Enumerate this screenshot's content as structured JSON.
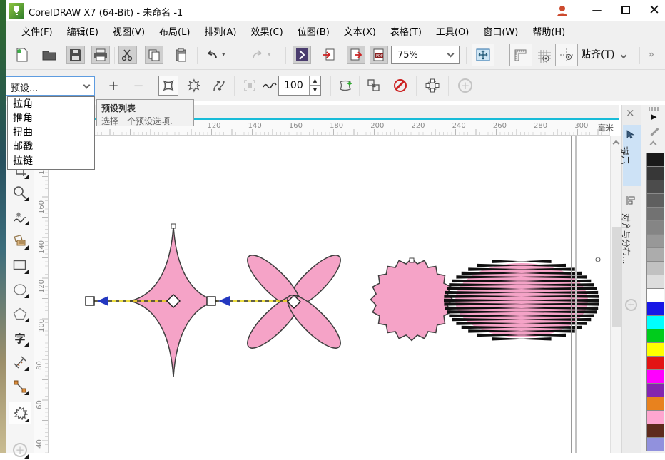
{
  "window": {
    "title": "CorelDRAW X7 (64-Bit) - 未命名 -1",
    "minimize_glyph": "—",
    "close_glyph": "✕"
  },
  "menu": {
    "items": [
      "文件(F)",
      "编辑(E)",
      "视图(V)",
      "布局(L)",
      "排列(A)",
      "效果(C)",
      "位图(B)",
      "文本(X)",
      "表格(T)",
      "工具(O)",
      "窗口(W)",
      "帮助(H)"
    ]
  },
  "toolbar": {
    "zoom_level": "75%",
    "snap_label": "贴齐(T)",
    "overflow_label": "»"
  },
  "property_bar": {
    "preset_value": "预设...",
    "plus_label": "+",
    "minus_label": "−",
    "amplitude_value": "100"
  },
  "preset_dropdown": {
    "items": [
      "拉角",
      "推角",
      "扭曲",
      "邮戳",
      "拉链"
    ]
  },
  "tooltip": {
    "title": "预设列表",
    "description": "选择一个预设选项."
  },
  "rulers": {
    "horizontal_labels": [
      "120",
      "140",
      "160",
      "180",
      "200",
      "220",
      "240",
      "260",
      "280",
      "300"
    ],
    "unit_label": "毫米",
    "vertical_labels": [
      "180",
      "160",
      "140",
      "120",
      "100",
      "80",
      "60",
      "40"
    ]
  },
  "toolbox": {
    "text_tool_glyph": "字"
  },
  "dockers": {
    "close_glyph": "×",
    "hints_tab": "提示",
    "align_tab": "对齐与分布...",
    "plus_glyph": "+"
  },
  "palette": {
    "expand_glyph": "▶",
    "colors": [
      "#1a1a1a",
      "#373737",
      "#4c4c4c",
      "#5f5f5f",
      "#727272",
      "#858585",
      "#989898",
      "#acacac",
      "#c1c1c1",
      "#dddddd",
      "#ffffff",
      "#1717e6",
      "#00ffff",
      "#00cc1c",
      "#ffff00",
      "#e31414",
      "#ff00ff",
      "#8426b0",
      "#e8821e",
      "#ffa6d0",
      "#5e2b1d",
      "#9191dd"
    ]
  },
  "canvas_style": {
    "shape_fill": "#f5a3c7",
    "shape_stroke": "#3f3f3f",
    "arrow_blue": "#2438c0",
    "dash_yellow": "#e6d200"
  }
}
